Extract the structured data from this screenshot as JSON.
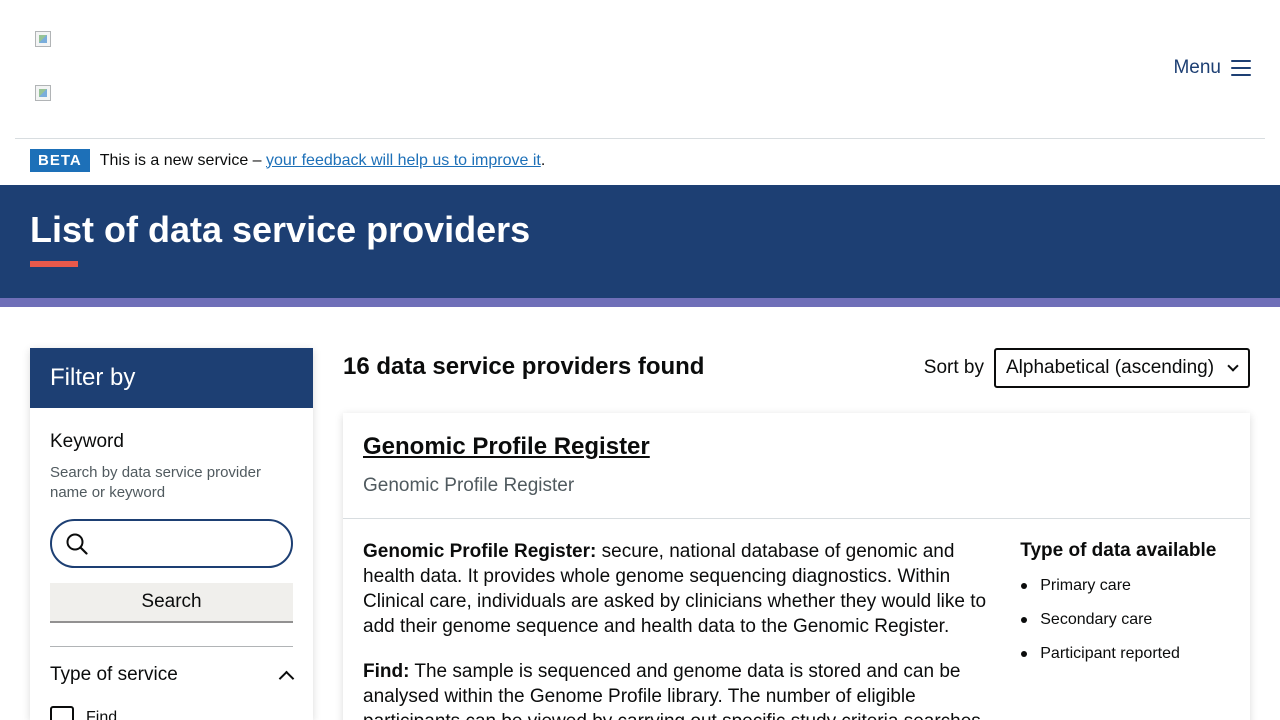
{
  "header": {
    "menu_label": "Menu"
  },
  "beta": {
    "tag": "BETA",
    "text": "This is a new service – ",
    "link": "your feedback will help us to improve it",
    "suffix": "."
  },
  "hero": {
    "title": "List of data service providers"
  },
  "filter": {
    "title": "Filter by",
    "keyword_label": "Keyword",
    "keyword_hint": "Search by data service provider name or keyword",
    "search_value": "",
    "search_button": "Search",
    "type_of_service_label": "Type of service",
    "options": [
      "Find"
    ]
  },
  "results": {
    "count_text": "16 data service providers found",
    "sort_label": "Sort by",
    "sort_value": "Alphabetical (ascending)"
  },
  "card": {
    "title": "Genomic Profile Register",
    "subtitle": "Genomic Profile Register",
    "p1_label": "Genomic Profile Register:",
    "p1_text": " secure, national database of genomic and health data. It provides whole genome sequencing diagnostics. Within Clinical care, individuals are asked by clinicians whether they would like to add their genome sequence and health data to the Genomic Register.",
    "p2_label": "Find:",
    "p2_text": " The sample is sequenced and genome data is stored and can be analysed within the Genome Profile library. The number of eligible participants can be viewed by carrying out specific study criteria searches.",
    "side_title": "Type of data available",
    "data_types": [
      "Primary care",
      "Secondary care",
      "Participant reported"
    ]
  }
}
